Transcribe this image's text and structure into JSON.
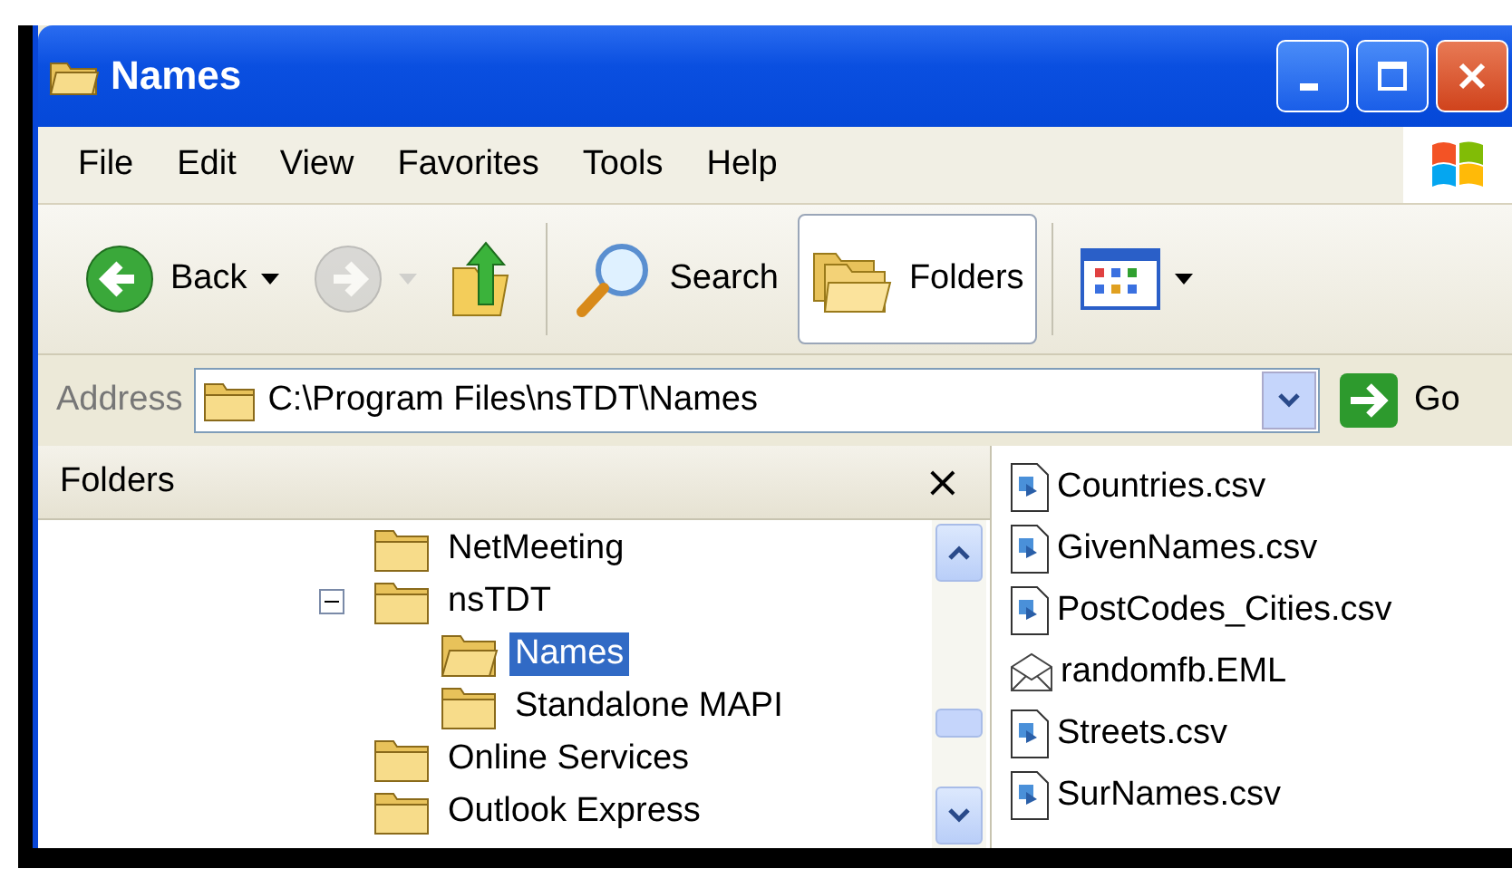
{
  "window": {
    "title": "Names"
  },
  "menu": [
    "File",
    "Edit",
    "View",
    "Favorites",
    "Tools",
    "Help"
  ],
  "toolbar": [
    {
      "kind": "back",
      "label": "Back",
      "pressed": false,
      "disabled": false
    },
    {
      "kind": "forward",
      "pressed": false,
      "disabled": true
    },
    {
      "kind": "up",
      "pressed": false,
      "disabled": false
    },
    {
      "kind": "search",
      "label": "Search",
      "pressed": false,
      "disabled": false
    },
    {
      "kind": "folders",
      "label": "Folders",
      "pressed": true,
      "disabled": false
    },
    {
      "kind": "views",
      "pressed": false,
      "disabled": false
    }
  ],
  "address": {
    "label": "Address",
    "value": "C:\\Program Files\\nsTDT\\Names",
    "go": "Go"
  },
  "folders_pane": {
    "title": "Folders",
    "close": "×",
    "tree": [
      {
        "name": "NetMeeting",
        "selected": false
      },
      {
        "name": "nsTDT",
        "selected": false,
        "expanded": true,
        "children": [
          {
            "name": "Names",
            "selected": true
          },
          {
            "name": "Standalone MAPI",
            "selected": false
          }
        ]
      },
      {
        "name": "Online Services",
        "selected": false
      },
      {
        "name": "Outlook Express",
        "selected": false
      }
    ]
  },
  "files": [
    {
      "name": "Countries.csv",
      "kind": "csv"
    },
    {
      "name": "GivenNames.csv",
      "kind": "csv"
    },
    {
      "name": "PostCodes_Cities.csv",
      "kind": "csv"
    },
    {
      "name": "randomfb.EML",
      "kind": "eml"
    },
    {
      "name": "Streets.csv",
      "kind": "csv"
    },
    {
      "name": "SurNames.csv",
      "kind": "csv"
    }
  ]
}
